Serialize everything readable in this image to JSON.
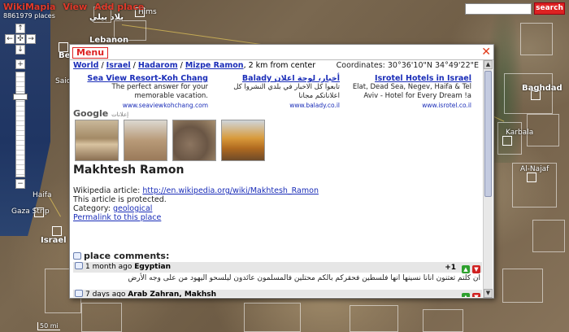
{
  "topbar": {
    "menu": [
      "WikiMapia",
      "View",
      "Add place"
    ],
    "place_count": "8861979 places",
    "search_label": "search"
  },
  "map": {
    "labels": [
      "Hims",
      "Lebanon",
      "Beir",
      "Saida",
      "Haifa",
      "Gaza Strip",
      "Israel",
      "Baghdad",
      "Karbala",
      "Al-Najaf"
    ],
    "arabic_label": "بلاد بيلي",
    "scale": "50 mi"
  },
  "window": {
    "menu_label": "Menu",
    "close_glyph": "✕",
    "breadcrumb": [
      "World",
      "Israel",
      "Hadarom",
      "Mizpe Ramon"
    ],
    "distance": ", 2 km from center",
    "coordinates": "Coordinates:  30°36'10\"N    34°49'22\"E"
  },
  "ads": [
    {
      "title": "Sea View Resort-Koh Chang",
      "desc": "The perfect answer for your memorable vacation.",
      "url": "www.seaviewkohchang.com"
    },
    {
      "title": "Balady أخبار، لوحة اعلان",
      "desc": "تابعوا كل الاخبار في بلدي النشروا كل اعلاناتكم مجانا",
      "url": "www.balady.co.il"
    },
    {
      "title": "Isrotel Hotels in Israel",
      "desc": "Elat, Dead Sea, Negev, Haifa & Tel Aviv - Hotel for Every Dream !a",
      "url": "www.isrotel.co.il"
    }
  ],
  "ads_by": {
    "brand": "Google",
    "suffix": "إعلانات"
  },
  "place": {
    "title": "Makhtesh Ramon",
    "wiki_label": "Wikipedia article: ",
    "wiki_url": "http://en.wikipedia.org/wiki/Makhtesh_Ramon",
    "protected": "This article is protected.",
    "category_label": "Category: ",
    "category": "geological",
    "permalink": "Permalink to this place"
  },
  "comments": {
    "heading": "place comments:",
    "items": [
      {
        "meta": "1 month ago ",
        "author": "Egyptian",
        "votes": "+1",
        "text": "ان كلتم تعتنون انانا نسينها انها فلسطين فحقركم بالكم محتلين فالمسلمون عائدون ليلسحو اليهود من على وجه الأرض"
      },
      {
        "meta": "7 days ago ",
        "author": "Arab Zahran, Makhsh",
        "votes": "",
        "text": ""
      }
    ]
  },
  "colors": {
    "accent": "#e23a2a",
    "link": "#1a2db8",
    "vote_up": "#2ea02e",
    "vote_down": "#d02222"
  }
}
